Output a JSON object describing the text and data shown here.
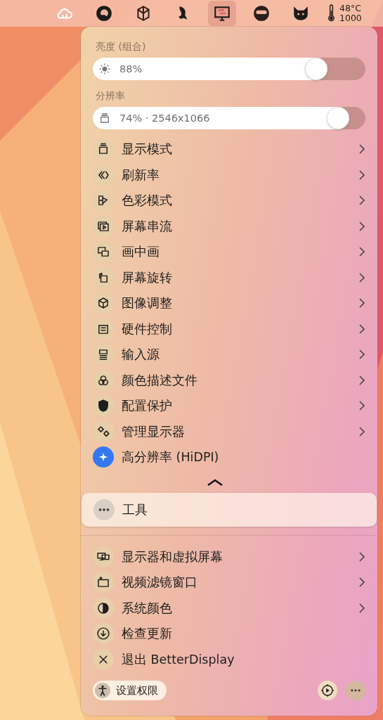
{
  "menubar": {
    "items": [
      {
        "selected": false
      },
      {
        "selected": false
      },
      {
        "selected": false
      },
      {
        "selected": false
      },
      {
        "selected": true
      },
      {
        "selected": false
      },
      {
        "selected": false
      }
    ],
    "sensor": {
      "temperature": "48°C",
      "value": "1000"
    }
  },
  "panel": {
    "sliders": [
      {
        "label": "亮度 (组合)",
        "reading": "88%"
      },
      {
        "label": "分辨率",
        "reading": "74% · 2546x1066"
      }
    ],
    "items": [
      {
        "label": "显示模式",
        "kind": "submenu"
      },
      {
        "label": "刷新率",
        "kind": "submenu"
      },
      {
        "label": "色彩模式",
        "kind": "submenu"
      },
      {
        "label": "屏幕串流",
        "kind": "submenu"
      },
      {
        "label": "画中画",
        "kind": "submenu"
      },
      {
        "label": "屏幕旋转",
        "kind": "submenu"
      },
      {
        "label": "图像调整",
        "kind": "submenu"
      },
      {
        "label": "硬件控制",
        "kind": "submenu"
      },
      {
        "label": "输入源",
        "kind": "submenu"
      },
      {
        "label": "颜色描述文件",
        "kind": "submenu"
      },
      {
        "label": "配置保护",
        "kind": "submenu"
      },
      {
        "label": "管理显示器",
        "kind": "submenu"
      },
      {
        "label": "高分辨率 (HiDPI)",
        "kind": "toggle",
        "on": true
      }
    ],
    "tools": {
      "label": "工具",
      "selected": true
    },
    "lower_items": [
      {
        "label": "显示器和虚拟屏幕",
        "kind": "submenu"
      },
      {
        "label": "视频滤镜窗口",
        "kind": "submenu"
      },
      {
        "label": "系统颜色",
        "kind": "submenu"
      },
      {
        "label": "检查更新",
        "kind": "action"
      },
      {
        "label": "退出 BetterDisplay",
        "kind": "action"
      }
    ],
    "footer": {
      "permissions_button": "设置权限"
    }
  }
}
